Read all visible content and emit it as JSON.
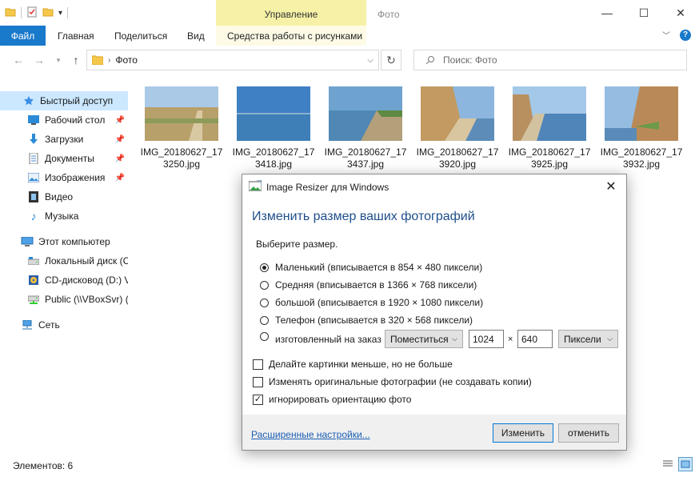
{
  "window": {
    "title": "Фото",
    "contextual_group": "Управление",
    "controls": [
      "minimize-icon",
      "maximize-icon",
      "close-icon"
    ]
  },
  "ribbon": {
    "tabs": [
      "Файл",
      "Главная",
      "Поделиться",
      "Вид",
      "Средства работы с рисунками"
    ]
  },
  "address": {
    "path": "Фото",
    "search_placeholder": "Поиск: Фото"
  },
  "sidebar": {
    "items": [
      {
        "label": "Быстрый доступ",
        "icon": "star-icon",
        "selected": true
      },
      {
        "label": "Рабочий стол",
        "icon": "desktop-icon",
        "pinned": true
      },
      {
        "label": "Загрузки",
        "icon": "download-icon",
        "pinned": true
      },
      {
        "label": "Документы",
        "icon": "documents-icon",
        "pinned": true
      },
      {
        "label": "Изображения",
        "icon": "pictures-icon",
        "pinned": true
      },
      {
        "label": "Видео",
        "icon": "video-icon"
      },
      {
        "label": "Музыка",
        "icon": "music-icon"
      },
      {
        "label": "Этот компьютер",
        "icon": "computer-icon"
      },
      {
        "label": "Локальный диск (C",
        "icon": "drive-icon"
      },
      {
        "label": "CD-дисковод (D:) V",
        "icon": "cd-icon"
      },
      {
        "label": "Public (\\\\VBoxSvr) (",
        "icon": "network-drive-icon"
      },
      {
        "label": "Сеть",
        "icon": "network-icon"
      }
    ]
  },
  "files": [
    {
      "line1": "IMG_20180627_17",
      "line2": "3250.jpg"
    },
    {
      "line1": "IMG_20180627_17",
      "line2": "3418.jpg"
    },
    {
      "line1": "IMG_20180627_17",
      "line2": "3437.jpg"
    },
    {
      "line1": "IMG_20180627_17",
      "line2": "3920.jpg"
    },
    {
      "line1": "IMG_20180627_17",
      "line2": "3925.jpg"
    },
    {
      "line1": "IMG_20180627_17",
      "line2": "3932.jpg"
    }
  ],
  "status": {
    "items_count": "Элементов: 6"
  },
  "dialog": {
    "title": "Image Resizer для Windows",
    "heading": "Изменить размер ваших фотографий",
    "prompt": "Выберите размер.",
    "options": [
      {
        "label": "Маленький (вписывается в 854 × 480 пиксели)",
        "selected": true
      },
      {
        "label": "Средняя (вписывается в 1366 × 768 пиксели)",
        "selected": false
      },
      {
        "label": "большой (вписывается в 1920 × 1080 пиксели)",
        "selected": false
      },
      {
        "label": "Телефон (вписывается в 320 × 568 пиксели)",
        "selected": false
      },
      {
        "label": "изготовленный на заказ",
        "selected": false
      }
    ],
    "custom": {
      "fit_mode": "Поместиться",
      "width": "1024",
      "times": "×",
      "height": "640",
      "unit": "Пиксели"
    },
    "checkboxes": [
      {
        "label": "Делайте картинки меньше, но не больше",
        "checked": false
      },
      {
        "label": "Изменять оригинальные фотографии (не создавать копии)",
        "checked": false
      },
      {
        "label": "игнорировать ориентацию фото",
        "checked": true
      }
    ],
    "advanced_link": "Расширенные настройки...",
    "resize_button": "Изменить",
    "cancel_button": "отменить"
  }
}
